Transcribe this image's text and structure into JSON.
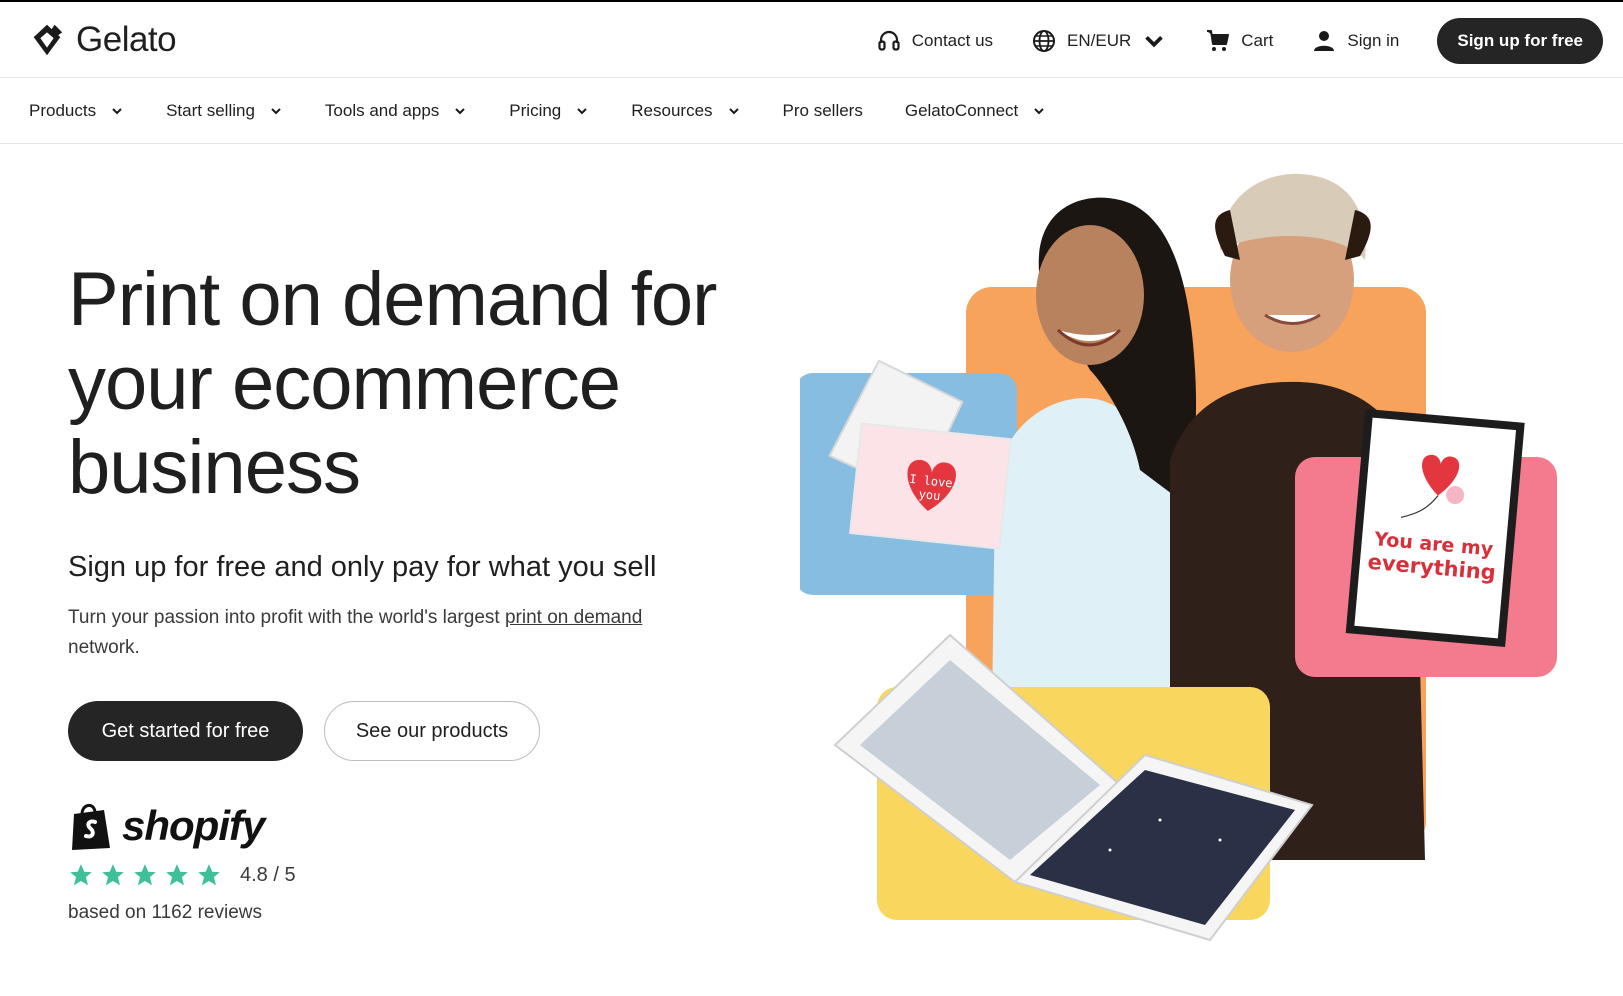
{
  "brand": {
    "name": "Gelato"
  },
  "topbar": {
    "contact": "Contact us",
    "locale": "EN/EUR",
    "cart": "Cart",
    "signin": "Sign in",
    "signup": "Sign up for free"
  },
  "nav": {
    "items": [
      {
        "label": "Products",
        "dropdown": true
      },
      {
        "label": "Start selling",
        "dropdown": true
      },
      {
        "label": "Tools and apps",
        "dropdown": true
      },
      {
        "label": "Pricing",
        "dropdown": true
      },
      {
        "label": "Resources",
        "dropdown": true
      },
      {
        "label": "Pro sellers",
        "dropdown": false
      },
      {
        "label": "GelatoConnect",
        "dropdown": true
      }
    ]
  },
  "hero": {
    "title_line1": "Print on demand for",
    "title_line2": "your ecommerce",
    "title_line3": "business",
    "subtitle": "Sign up for free and only pay for what you sell",
    "desc_before": "Turn your passion into profit with the world's largest ",
    "desc_link": "print on demand",
    "desc_after": " network.",
    "cta_primary": "Get started for free",
    "cta_secondary": "See our products"
  },
  "review": {
    "platform": "shopify",
    "rating": "4.8 / 5",
    "stars": 5,
    "count_text": "based on 1162 reviews"
  },
  "illustration": {
    "card_text_1": "I love",
    "card_text_2": "you",
    "poster_text_1": "You are my",
    "poster_text_2": "everything"
  },
  "colors": {
    "dark": "#252525",
    "star_green": "#3fbf9c",
    "tile_orange": "#f7a35c",
    "tile_blue": "#86bde0",
    "tile_pink": "#f47a8e",
    "tile_yellow": "#f9d75e"
  }
}
